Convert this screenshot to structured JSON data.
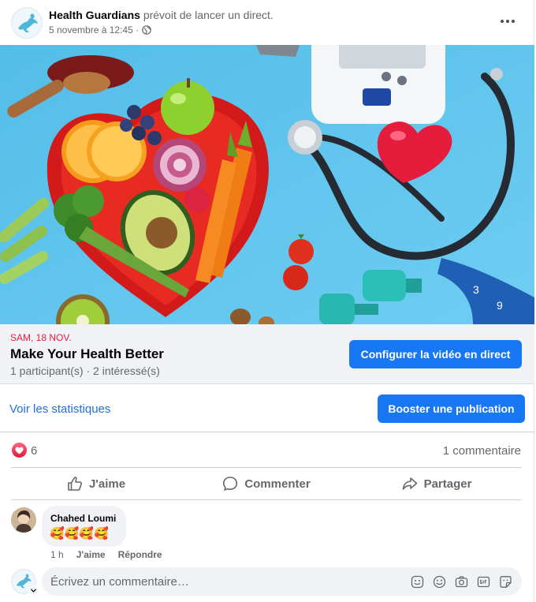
{
  "post": {
    "page_name": "Health Guardians",
    "action_text": "prévoit de lancer un direct.",
    "timestamp": "5 novembre à 12:45 ·",
    "privacy_icon": "globe-icon"
  },
  "event": {
    "date": "SAM, 18 NOV.",
    "title": "Make Your Health Better",
    "subtitle": "1 participant(s) · 2 intéressé(s)",
    "live_button": "Configurer la vidéo en direct"
  },
  "stats": {
    "link": "Voir les statistiques",
    "boost_button": "Booster une publication"
  },
  "reactions": {
    "count": "6",
    "comments": "1 commentaire",
    "icon": "love-reaction-icon"
  },
  "actions": {
    "like": "J'aime",
    "comment": "Commenter",
    "share": "Partager"
  },
  "comment": {
    "author": "Chahed Loumi",
    "text": "🥰🥰🥰🥰",
    "time": "1 h",
    "like": "J'aime",
    "reply": "Répondre"
  },
  "composer": {
    "placeholder": "Écrivez un commentaire…",
    "tools": [
      "sticker-icon",
      "emoji-icon",
      "camera-icon",
      "gif-icon",
      "avatar-sticker-icon"
    ]
  },
  "colors": {
    "brand_blue": "#1877f2",
    "link_blue": "#216fdb",
    "event_date_red": "#e41e3f",
    "photo_background": "#58c0ea"
  }
}
